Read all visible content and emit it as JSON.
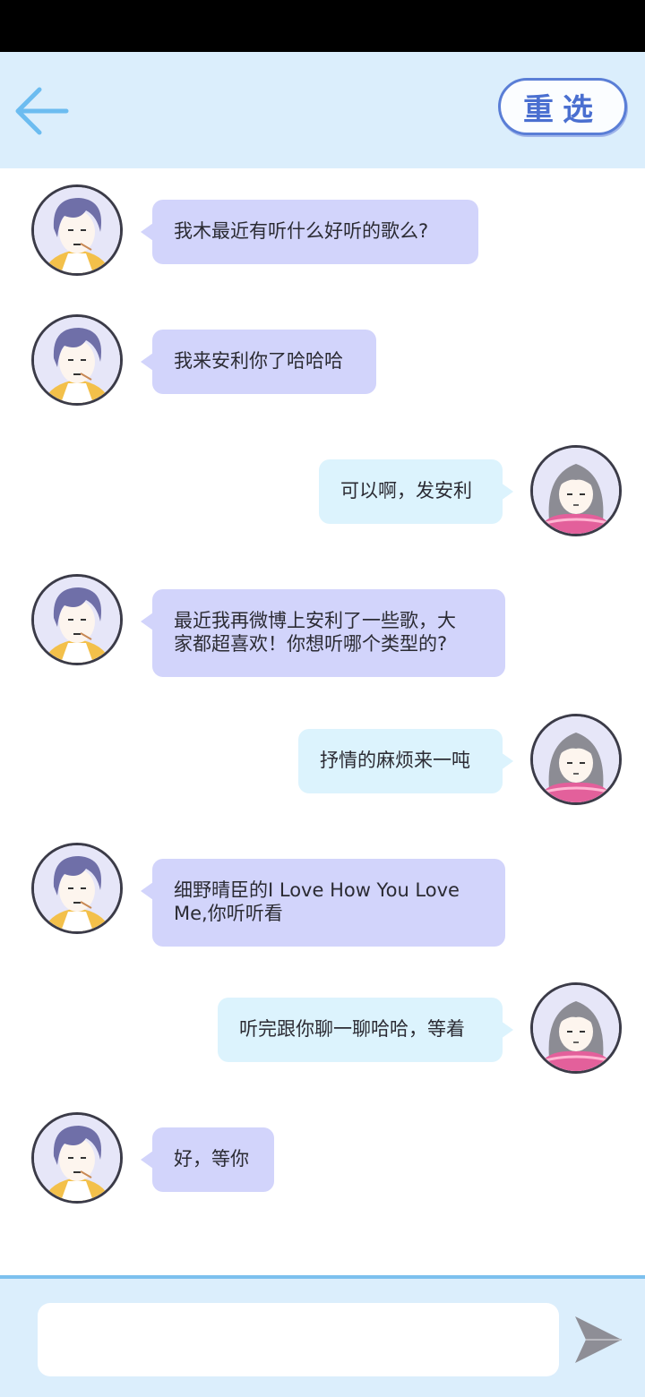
{
  "header": {
    "back_icon": "arrow-left-icon",
    "reselect_label": "重选",
    "accent_color": "#5a7ed6"
  },
  "messages": [
    {
      "side": "left",
      "avatar": "male-avatar",
      "lines": [
        "我木最近有听什么好听的歌么?"
      ]
    },
    {
      "side": "left",
      "avatar": "male-avatar",
      "lines": [
        "我来安利你了哈哈哈"
      ]
    },
    {
      "side": "right",
      "avatar": "female-avatar",
      "lines": [
        "可以啊，发安利"
      ]
    },
    {
      "side": "left",
      "avatar": "male-avatar",
      "lines": [
        "最近我再微博上安利了一些歌，大",
        "家都超喜欢！你想听哪个类型的?"
      ]
    },
    {
      "side": "right",
      "avatar": "female-avatar",
      "lines": [
        "抒情的麻烦来一吨"
      ]
    },
    {
      "side": "left",
      "avatar": "male-avatar",
      "lines": [
        "细野晴臣的I Love How You Love",
        "Me,你听听看"
      ]
    },
    {
      "side": "right",
      "avatar": "female-avatar",
      "lines": [
        "听完跟你聊一聊哈哈，等着"
      ]
    },
    {
      "side": "left",
      "avatar": "male-avatar",
      "lines": [
        "好，等你"
      ]
    }
  ],
  "composer": {
    "input_value": "",
    "send_icon": "send-arrow-icon"
  },
  "colors": {
    "header_bg": "#dbeefc",
    "left_bubble": "#d2d4fb",
    "right_bubble": "#dcf3fd",
    "divider": "#7cc0ee"
  }
}
